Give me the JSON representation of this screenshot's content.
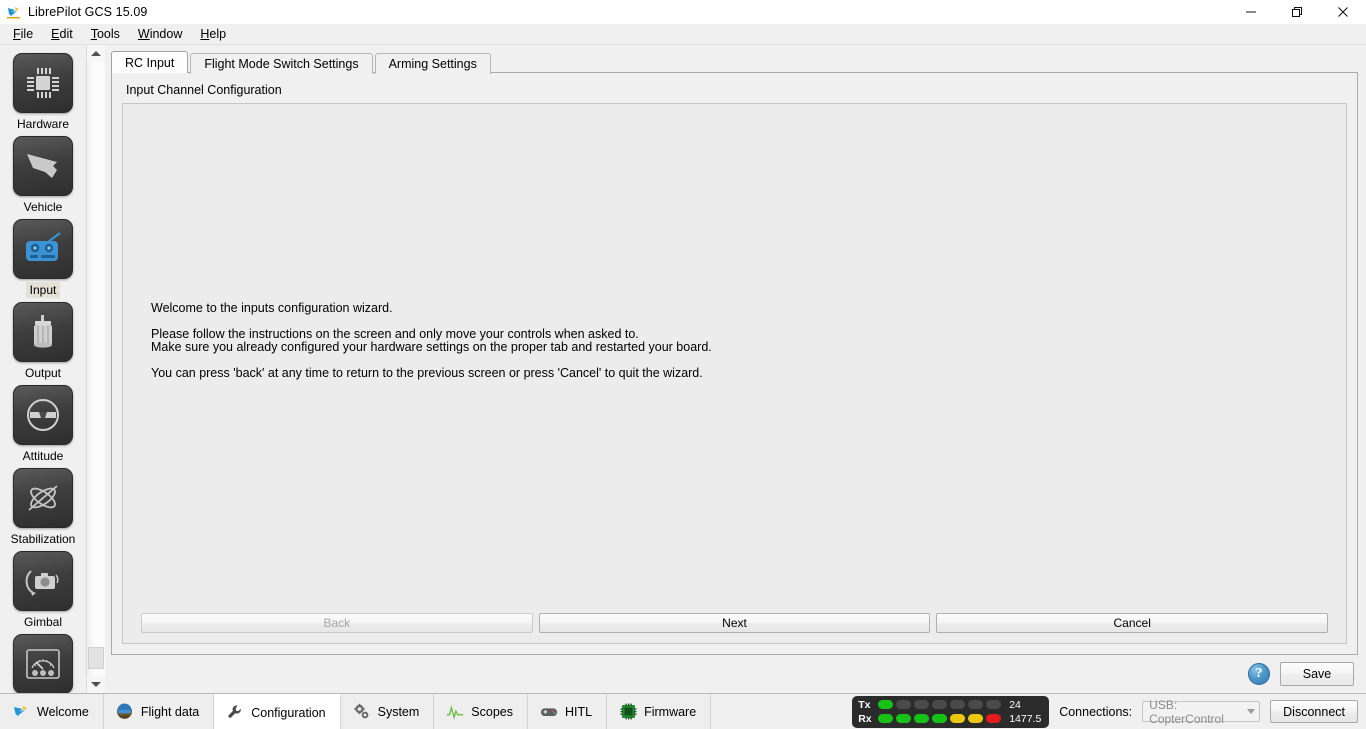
{
  "window": {
    "title": "LibrePilot GCS 15.09",
    "app_icon": "librepilot-bird-icon",
    "controls": {
      "minimize": "minimize-icon",
      "restore": "restore-icon",
      "close": "close-icon"
    }
  },
  "menubar": {
    "items": [
      {
        "label": "File",
        "mnemonic": "F"
      },
      {
        "label": "Edit",
        "mnemonic": "E"
      },
      {
        "label": "Tools",
        "mnemonic": "T"
      },
      {
        "label": "Window",
        "mnemonic": "W"
      },
      {
        "label": "Help",
        "mnemonic": "H"
      }
    ]
  },
  "sidebar": {
    "items": [
      {
        "label": "Hardware",
        "icon": "chip-icon",
        "selected": false
      },
      {
        "label": "Vehicle",
        "icon": "aircraft-icon",
        "selected": false
      },
      {
        "label": "Input",
        "icon": "rc-transmitter-icon",
        "selected": true
      },
      {
        "label": "Output",
        "icon": "motor-icon",
        "selected": false
      },
      {
        "label": "Attitude",
        "icon": "spirit-level-icon",
        "selected": false
      },
      {
        "label": "Stabilization",
        "icon": "gyro-orbit-icon",
        "selected": false
      },
      {
        "label": "Gimbal",
        "icon": "camera-gimbal-icon",
        "selected": false
      },
      {
        "label": "",
        "icon": "gauge-icon",
        "selected": false
      }
    ],
    "scrollbar": {
      "up_arrow": "scroll-up-icon",
      "down_arrow": "scroll-down-icon"
    }
  },
  "main": {
    "tabs": [
      {
        "label": "RC Input",
        "active": true
      },
      {
        "label": "Flight Mode Switch Settings",
        "active": false
      },
      {
        "label": "Arming Settings",
        "active": false
      }
    ],
    "pane_title": "Input Channel Configuration",
    "wizard": {
      "line1": "Welcome to the inputs configuration wizard.",
      "line2": "Please follow the instructions on the screen and only move your controls when asked to.",
      "line3": "Make sure you already configured your hardware settings on the proper tab and restarted your board.",
      "line4": "You can press 'back' at any time to return to the previous screen or press 'Cancel' to quit the wizard.",
      "buttons": {
        "back": "Back",
        "next": "Next",
        "cancel": "Cancel"
      },
      "back_disabled": true
    },
    "footer": {
      "help": "?",
      "help_icon": "help-question-icon",
      "save": "Save"
    }
  },
  "taskbar": {
    "tabs": [
      {
        "label": "Welcome",
        "icon": "bird-icon",
        "active": false
      },
      {
        "label": "Flight data",
        "icon": "pilot-helmet-icon",
        "active": false
      },
      {
        "label": "Configuration",
        "icon": "wrench-icon",
        "active": true
      },
      {
        "label": "System",
        "icon": "gears-icon",
        "active": false
      },
      {
        "label": "Scopes",
        "icon": "waveform-icon",
        "active": false
      },
      {
        "label": "HITL",
        "icon": "gamepad-icon",
        "active": false
      },
      {
        "label": "Firmware",
        "icon": "chip-green-icon",
        "active": false
      }
    ],
    "telemetry": {
      "tx_label": "Tx",
      "rx_label": "Rx",
      "tx_value": "24",
      "rx_value": "1477.5",
      "tx_leds": [
        "green",
        "off",
        "off",
        "off",
        "off",
        "off",
        "off"
      ],
      "rx_leds": [
        "green",
        "green",
        "green",
        "green",
        "yellow",
        "yellow",
        "red"
      ]
    },
    "connections_label": "Connections:",
    "connection_value": "USB: CopterControl",
    "disconnect": "Disconnect"
  },
  "colors": {
    "accent_blue": "#3b93d4",
    "led_green": "#17c217",
    "led_yellow": "#ecc70d",
    "led_red": "#e21b1b",
    "window_bg": "#f0f0f0",
    "panel_bg": "#ececec"
  }
}
